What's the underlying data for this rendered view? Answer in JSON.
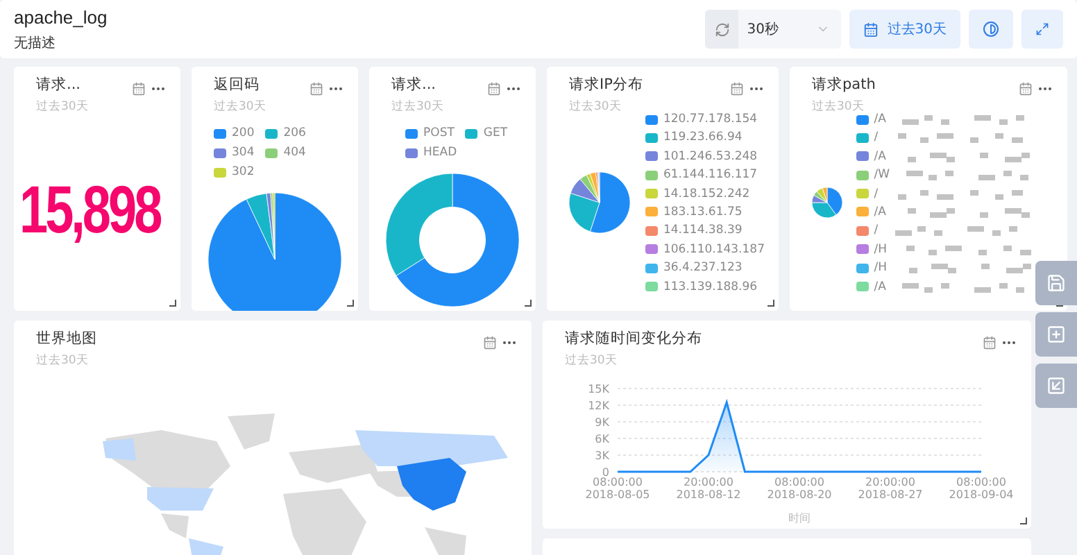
{
  "header": {
    "title": "apache_log",
    "description": "无描述"
  },
  "toolbar": {
    "refresh_interval": "30秒",
    "time_range": "过去30天"
  },
  "panels": [
    {
      "kind": "number",
      "title": "请求...",
      "subtitle": "过去30天",
      "value": "15,898"
    },
    {
      "kind": "pie",
      "title": "返回码",
      "subtitle": "过去30天",
      "legend": [
        {
          "label": "200",
          "color": "#1f8cf5"
        },
        {
          "label": "206",
          "color": "#19b6c9"
        },
        {
          "label": "304",
          "color": "#7585dc"
        },
        {
          "label": "404",
          "color": "#8ccf7a"
        },
        {
          "label": "302",
          "color": "#c9d63c"
        }
      ]
    },
    {
      "kind": "donut",
      "title": "请求...",
      "subtitle": "过去30天",
      "legend": [
        {
          "label": "POST",
          "color": "#1f8cf5"
        },
        {
          "label": "GET",
          "color": "#19b6c9"
        },
        {
          "label": "HEAD",
          "color": "#7585dc"
        }
      ]
    },
    {
      "kind": "pie-list",
      "title": "请求IP分布",
      "subtitle": "过去30天",
      "legend": [
        {
          "label": "120.77.178.154",
          "color": "#1f8cf5"
        },
        {
          "label": "119.23.66.94",
          "color": "#19b6c9"
        },
        {
          "label": "101.246.53.248",
          "color": "#7585dc"
        },
        {
          "label": "61.144.116.117",
          "color": "#8ccf7a"
        },
        {
          "label": "14.18.152.242",
          "color": "#c9d63c"
        },
        {
          "label": "183.13.61.75",
          "color": "#fbb03b"
        },
        {
          "label": "14.114.38.39",
          "color": "#f4886b"
        },
        {
          "label": "106.110.143.187",
          "color": "#b57ee0"
        },
        {
          "label": "36.4.237.123",
          "color": "#3fb5ec"
        },
        {
          "label": "113.139.188.96",
          "color": "#7ddba0"
        }
      ]
    },
    {
      "kind": "pie-list-small",
      "title": "请求path",
      "subtitle": "过去30天",
      "legend": [
        {
          "label": "/A",
          "color": "#1f8cf5"
        },
        {
          "label": "/",
          "color": "#19b6c9"
        },
        {
          "label": "/A",
          "color": "#7585dc"
        },
        {
          "label": "/W",
          "color": "#8ccf7a"
        },
        {
          "label": "/",
          "color": "#c9d63c"
        },
        {
          "label": "/A",
          "color": "#fbb03b"
        },
        {
          "label": "/",
          "color": "#f4886b"
        },
        {
          "label": "/H",
          "color": "#b57ee0"
        },
        {
          "label": "/H",
          "color": "#3fb5ec"
        },
        {
          "label": "/A",
          "color": "#7ddba0"
        }
      ]
    }
  ],
  "map_panel": {
    "title": "世界地图",
    "subtitle": "过去30天"
  },
  "trend_panel": {
    "title": "请求随时间变化分布",
    "subtitle": "过去30天",
    "chart_data": {
      "type": "area",
      "grid": true,
      "xlabel": "时间",
      "categories": [
        "08:00:00 2018-08-05",
        null,
        null,
        null,
        null,
        "20:00:00 2018-08-12",
        null,
        null,
        null,
        null,
        "08:00:00 2018-08-20",
        null,
        null,
        null,
        null,
        "20:00:00 2018-08-27",
        null,
        null,
        null,
        null,
        "08:00:00 2018-09-04"
      ],
      "series": [
        {
          "color": "#1f8cf5",
          "values": [
            0,
            0,
            0,
            0,
            0,
            3000,
            12500,
            0,
            0,
            0,
            0,
            0,
            0,
            0,
            0,
            0,
            0,
            0,
            0,
            0,
            0
          ]
        }
      ],
      "ylim": [
        0,
        15000
      ],
      "yticks": [
        {
          "value": 0,
          "label": "0"
        },
        {
          "value": 3000,
          "label": "3K"
        },
        {
          "value": 6000,
          "label": "6K"
        },
        {
          "value": 9000,
          "label": "9K"
        },
        {
          "value": 12000,
          "label": "12K"
        },
        {
          "value": 15000,
          "label": "15K"
        }
      ]
    }
  }
}
